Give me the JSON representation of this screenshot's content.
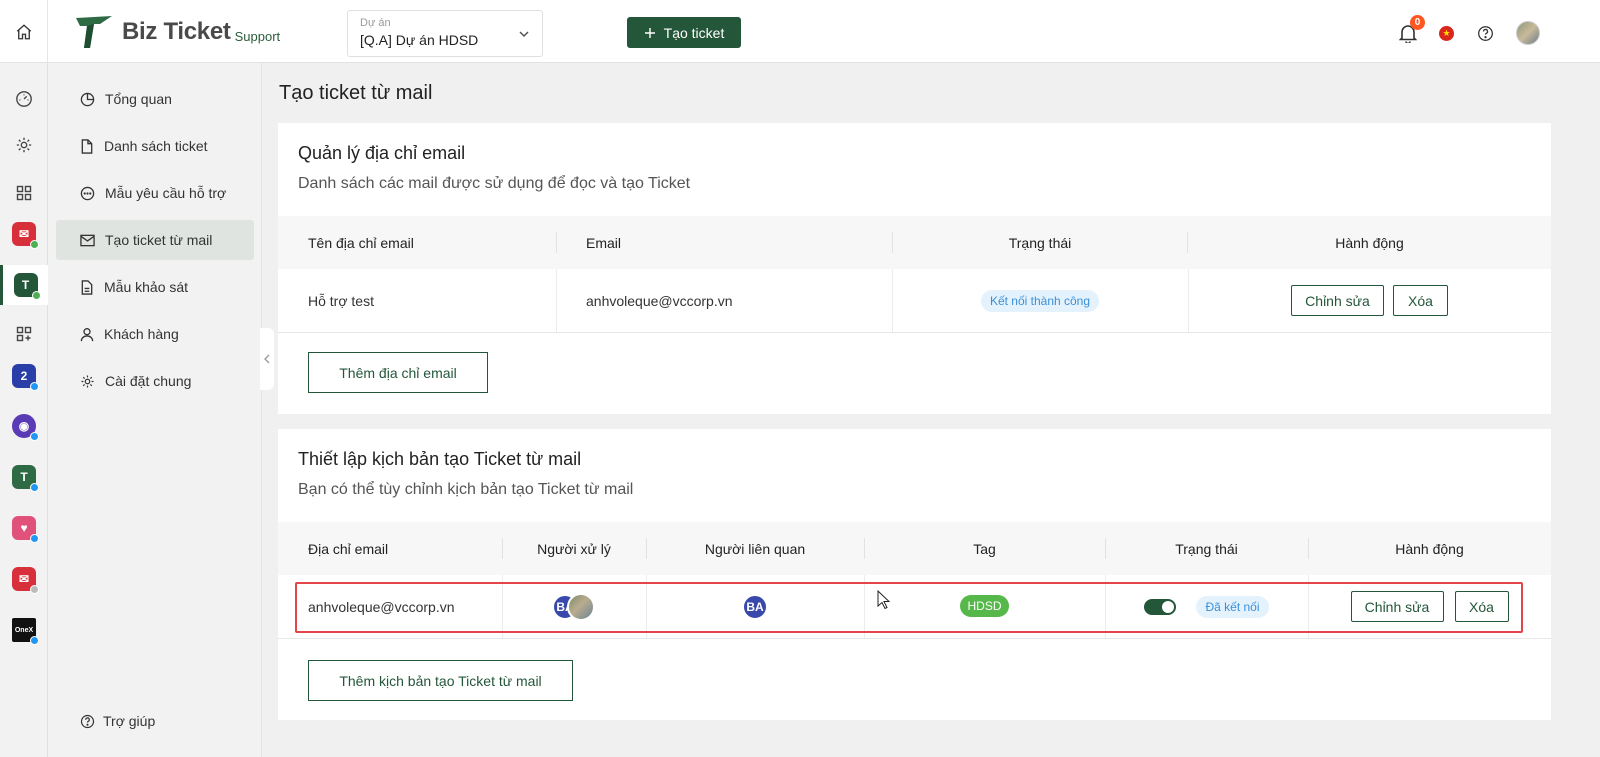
{
  "header": {
    "logo_text": "Biz Ticket",
    "logo_sub": "Support",
    "project_label": "Dự án",
    "project_value": "[Q.A] Dự án HDSD",
    "create_label": "Tạo ticket",
    "notif_count": "0",
    "colors": {
      "brand": "#24563a",
      "badge": "#ff5722"
    }
  },
  "sidebar": {
    "items": [
      {
        "label": "Tổng quan",
        "icon": "pie-chart-icon"
      },
      {
        "label": "Danh sách ticket",
        "icon": "file-icon"
      },
      {
        "label": "Mẫu yêu cầu hỗ trợ",
        "icon": "chat-icon"
      },
      {
        "label": "Tạo ticket từ mail",
        "icon": "mail-icon",
        "active": true
      },
      {
        "label": "Mẫu khảo sát",
        "icon": "document-icon"
      },
      {
        "label": "Khách hàng",
        "icon": "user-icon"
      },
      {
        "label": "Cài đặt chung",
        "icon": "gear-icon"
      }
    ],
    "help_label": "Trợ giúp"
  },
  "page": {
    "title": "Tạo ticket từ mail"
  },
  "email_section": {
    "title": "Quản lý địa chỉ email",
    "subtitle": "Danh sách các mail được sử dụng để đọc và tạo Ticket",
    "columns": [
      "Tên địa chỉ email",
      "Email",
      "Trạng thái",
      "Hành động"
    ],
    "rows": [
      {
        "name": "Hỗ trợ test",
        "email": "anhvoleque@vccorp.vn",
        "status": "Kết nối thành công",
        "edit": "Chỉnh sửa",
        "delete": "Xóa"
      }
    ],
    "add_label": "Thêm địa chỉ email"
  },
  "script_section": {
    "title": "Thiết lập kịch bản tạo Ticket từ mail",
    "subtitle": "Bạn có thể tùy chỉnh kịch bản tạo Ticket từ mail",
    "columns": [
      "Địa chỉ email",
      "Người xử lý",
      "Người liên quan",
      "Tag",
      "Trạng thái",
      "Hành động"
    ],
    "rows": [
      {
        "email": "anhvoleque@vccorp.vn",
        "handler_initials": "BA",
        "related_initials": "BA",
        "tag": "HDSD",
        "toggle_on": true,
        "status": "Đã kết nối",
        "edit": "Chỉnh sửa",
        "delete": "Xóa"
      }
    ],
    "add_label": "Thêm kịch bản tạo Ticket từ mail"
  }
}
